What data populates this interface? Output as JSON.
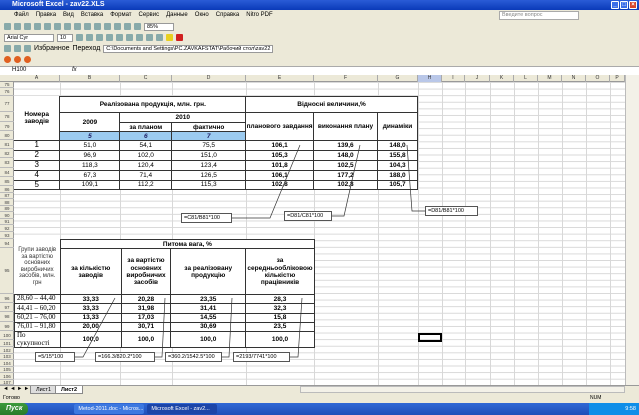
{
  "window": {
    "title": "Microsoft Excel - zav22.XLS"
  },
  "menu": [
    "Файл",
    "Правка",
    "Вид",
    "Вставка",
    "Формат",
    "Сервис",
    "Данные",
    "Окно",
    "Справка",
    "Nitro PDF"
  ],
  "help_placeholder": "Введите вопрос",
  "toolbar": {
    "zoom": "85%",
    "font": "Arial Cyr",
    "size": "10",
    "favorites": "Избранное",
    "goto": "Переход",
    "path": "C:\\Documents and Settings\\PC.ZAVKAFSTAT\\Рабочий стол\\zav22"
  },
  "formula_bar": {
    "name_box": "H100",
    "fx": "fx",
    "value": ""
  },
  "columns": [
    "A",
    "B",
    "C",
    "D",
    "E",
    "F",
    "G",
    "H",
    "I",
    "J",
    "K",
    "L",
    "M",
    "N",
    "O",
    "P"
  ],
  "selected_column": "H",
  "rows": [
    "75",
    "76",
    "77",
    "78",
    "79",
    "80",
    "81",
    "82",
    "83",
    "84",
    "85",
    "86",
    "87",
    "88",
    "89",
    "90",
    "91",
    "92",
    "93",
    "94",
    "95",
    "96",
    "97",
    "98",
    "99",
    "100",
    "101",
    "102",
    "103",
    "104",
    "105",
    "106",
    "107"
  ],
  "table1": {
    "row_header": "Номера заводів",
    "group1": "Реалізована продукція, млн. грн.",
    "group2": "Відносні величини,%",
    "y2009": "2009",
    "y2010": "2010",
    "plan": "за планом",
    "fact": "фактично",
    "rel": [
      "планового завдання",
      "виконання плану",
      "динаміки"
    ],
    "col_nums": [
      "5",
      "6",
      "7"
    ],
    "rows": [
      [
        "1",
        "51,0",
        "54,1",
        "75,5",
        "106,1",
        "139,6",
        "148,0"
      ],
      [
        "2",
        "96,9",
        "102,0",
        "151,0",
        "105,3",
        "148,0",
        "155,8"
      ],
      [
        "3",
        "118,3",
        "120,4",
        "123,4",
        "101,8",
        "102,5",
        "104,3"
      ],
      [
        "4",
        "67,3",
        "71,4",
        "126,5",
        "106,1",
        "177,2",
        "188,0"
      ],
      [
        "5",
        "109,1",
        "112,2",
        "115,3",
        "102,8",
        "102,8",
        "105,7"
      ]
    ],
    "formulas": [
      "=C81/B81*100",
      "=D81/C81*100",
      "=D81/B81*100"
    ]
  },
  "table2": {
    "row_header": "Групи заводів за вартістю основних виробничих засобів, млн. грн",
    "group": "Питома вага, %",
    "cols": [
      "за кількістю заводів",
      "за вартістю основних виробничих засобів",
      "за реалізовану продукцію",
      "за середньообліковою кількістю працівників"
    ],
    "rows": [
      [
        "28,60 – 44,40",
        "33,33",
        "20,28",
        "23,35",
        "28,3"
      ],
      [
        "44,41 – 60,20",
        "33,33",
        "31,98",
        "31,41",
        "32,3"
      ],
      [
        "60,21 – 76,00",
        "13,33",
        "17,03",
        "14,55",
        "15,8"
      ],
      [
        "76,01 – 91,80",
        "20,00",
        "30,71",
        "30,69",
        "23,5"
      ],
      [
        "По сукупності",
        "100,0",
        "100,0",
        "100,0",
        "100,0"
      ]
    ],
    "formulas": [
      "=5/15*100",
      "=166.3/820.2*100",
      "=360.2/1542.5*100",
      "=2193/7741*100"
    ]
  },
  "sheets": [
    "Лист1",
    "Лист2"
  ],
  "active_sheet": "Лист2",
  "status": {
    "left": "Готово",
    "num": "NUM"
  },
  "taskbar": {
    "start": "Пуск",
    "tasks": [
      "Metod-2011.doc - Micros...",
      "Microsoft Excel - zav2..."
    ],
    "clock": "9:58"
  }
}
